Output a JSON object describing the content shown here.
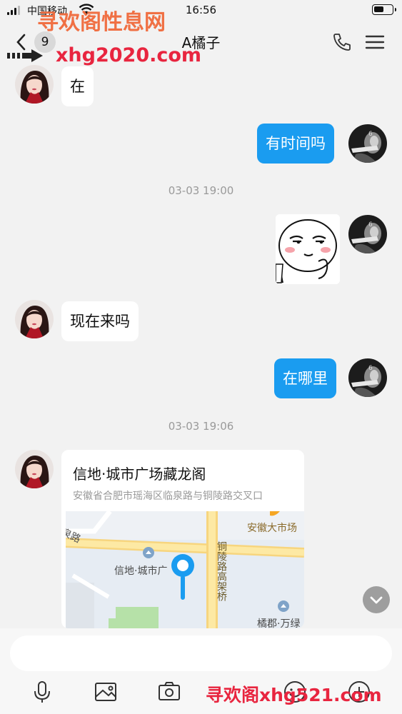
{
  "status_bar": {
    "carrier": "中国移动",
    "time": "16:56",
    "battery_level": 0.55
  },
  "nav": {
    "unread_count": "9",
    "title": "A橘子"
  },
  "watermarks": {
    "top_text": "寻欢阁性息网",
    "top_url": "xhg2020.com",
    "bottom_text": "寻欢阁xhg521.com"
  },
  "messages": [
    {
      "side": "in",
      "text": "在"
    },
    {
      "side": "out",
      "text": "有时间吗"
    },
    {
      "side": "out",
      "type": "sticker"
    },
    {
      "side": "in",
      "text": "现在来吗"
    },
    {
      "side": "out",
      "text": "在哪里"
    },
    {
      "side": "in",
      "type": "location"
    }
  ],
  "timestamps": [
    "03-03 19:00",
    "03-03 19:06"
  ],
  "location_card": {
    "title": "信地·城市广场藏龙阁",
    "address": "安徽省合肥市瑶海区临泉路与铜陵路交叉口",
    "map_labels": {
      "road_top_left": "泉路",
      "poi_right": "安徽大市场",
      "poi_center": "信地·城市广",
      "road_vertical": "铜陵路高架桥",
      "poi_bottom_right": "橘郡·万绿"
    }
  },
  "input": {
    "placeholder": ""
  },
  "toolbar": [
    "microphone-icon",
    "image-icon",
    "camera-icon",
    "emoji-icon",
    "plus-icon"
  ],
  "colors": {
    "background": "#f2f2f2",
    "outgoing_bubble": "#1a9cf0",
    "incoming_bubble": "#ffffff",
    "map_pin": "#1a9cf0",
    "watermark_red": "#e8253f"
  }
}
